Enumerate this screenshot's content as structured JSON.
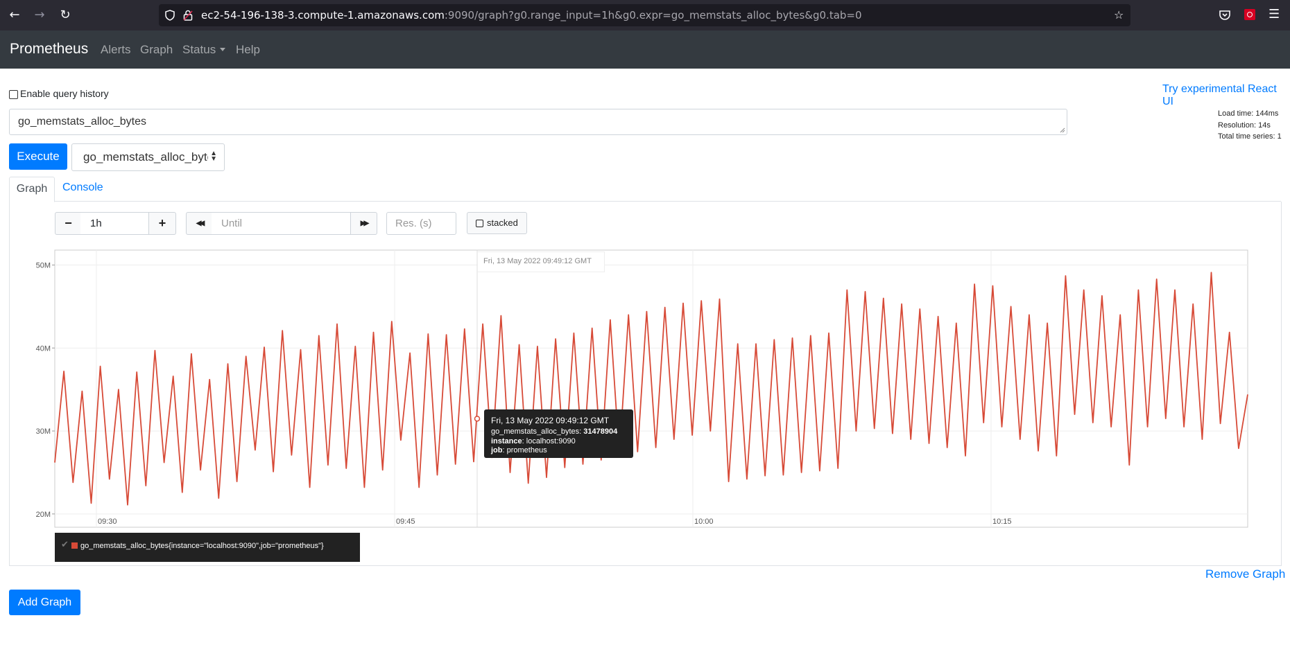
{
  "browser": {
    "url_host": "ec2-54-196-138-3.compute-1.amazonaws.com",
    "url_rest": ":9090/graph?g0.range_input=1h&g0.expr=go_memstats_alloc_bytes&g0.tab=0"
  },
  "navbar": {
    "brand": "Prometheus",
    "links": [
      "Alerts",
      "Graph",
      "Status",
      "Help"
    ]
  },
  "page": {
    "history_label": "Enable query history",
    "react_link": "Try experimental React UI",
    "stats": [
      "Load time: 144ms",
      "Resolution: 14s",
      "Total time series: 1"
    ],
    "expression": "go_memstats_alloc_bytes",
    "execute_label": "Execute",
    "metric_select": "go_memstats_alloc_bytes",
    "tabs": [
      "Graph",
      "Console"
    ],
    "controls": {
      "minus": "−",
      "range": "1h",
      "plus": "+",
      "back": "◀◀",
      "until_placeholder": "Until",
      "forward": "▶▶",
      "res_placeholder": "Res. (s)",
      "stacked": "stacked"
    },
    "remove_label": "Remove Graph",
    "add_label": "Add Graph"
  },
  "chart_data": {
    "type": "line",
    "xlabel": "",
    "ylabel": "",
    "ylim": [
      18400000,
      51800000
    ],
    "x_ticks": [
      "09:30",
      "09:45",
      "10:00",
      "10:15"
    ],
    "y_ticks": [
      "20M",
      "30M",
      "40M",
      "50M"
    ],
    "grid": true,
    "series": [
      {
        "name": "go_memstats_alloc_bytes{instance=\"localhost:9090\",job=\"prometheus\"}",
        "color": "#d74a37",
        "values": [
          26.2,
          37.2,
          23.8,
          34.8,
          21.3,
          37.8,
          24.2,
          35.0,
          21.1,
          37.1,
          23.4,
          39.7,
          26.2,
          36.6,
          22.6,
          39.3,
          25.3,
          36.2,
          21.9,
          38.1,
          23.9,
          39.0,
          27.7,
          40.1,
          25.1,
          42.1,
          27.1,
          39.8,
          23.2,
          41.5,
          25.9,
          42.9,
          25.5,
          40.2,
          23.2,
          41.9,
          25.3,
          43.2,
          28.9,
          39.4,
          23.2,
          41.7,
          24.7,
          41.6,
          26.0,
          42.3,
          26.3,
          42.9,
          26.8,
          43.9,
          25.0,
          40.4,
          23.7,
          40.2,
          24.4,
          41.1,
          25.6,
          41.8,
          26.0,
          42.4,
          26.5,
          43.4,
          27.0,
          44.0,
          27.5,
          44.4,
          28.0,
          44.9,
          29.0,
          45.4,
          29.5,
          45.7,
          30.0,
          45.9,
          23.9,
          40.5,
          24.2,
          40.5,
          24.6,
          41.0,
          24.7,
          41.2,
          25.0,
          41.5,
          25.2,
          41.8,
          25.5,
          47.0,
          30.0,
          46.8,
          30.3,
          46.0,
          29.7,
          45.3,
          29.0,
          44.7,
          28.5,
          43.8,
          28.0,
          43.0,
          27.0,
          47.7,
          31.0,
          47.5,
          30.5,
          45.0,
          29.0,
          44.0,
          27.6,
          43.0,
          27.0,
          48.7,
          32.0,
          47.0,
          31.0,
          46.3,
          30.5,
          44.0,
          25.9,
          47.0,
          30.5,
          48.3,
          31.5,
          47.0,
          30.5,
          45.3,
          29.0,
          49.1,
          30.9,
          41.9,
          27.9,
          34.4
        ]
      }
    ],
    "hover": {
      "time": "Fri, 13 May 2022 09:49:12 GMT",
      "metric": "go_memstats_alloc_bytes: ",
      "value": "31478904",
      "instance_label": "instance",
      "instance_value": ": localhost:9090",
      "job_label": "job",
      "job_value": ": prometheus"
    }
  }
}
